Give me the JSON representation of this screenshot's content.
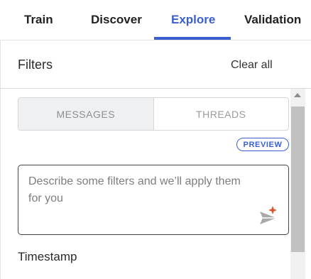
{
  "tabs": [
    {
      "label": "Train",
      "active": false
    },
    {
      "label": "Discover",
      "active": false
    },
    {
      "label": "Explore",
      "active": true
    },
    {
      "label": "Validation",
      "active": false
    }
  ],
  "filters": {
    "title": "Filters",
    "clear_all": "Clear all"
  },
  "segmented": {
    "options": [
      "MESSAGES",
      "THREADS"
    ],
    "selected": "MESSAGES"
  },
  "preview_badge": "PREVIEW",
  "prompt": {
    "placeholder": "Describe some filters and we’ll apply them for you",
    "send_icon": "send-sparkle-icon"
  },
  "section": {
    "timestamp_label": "Timestamp"
  },
  "colors": {
    "accent": "#3c5fcf",
    "sparkle": "#e0532f"
  }
}
